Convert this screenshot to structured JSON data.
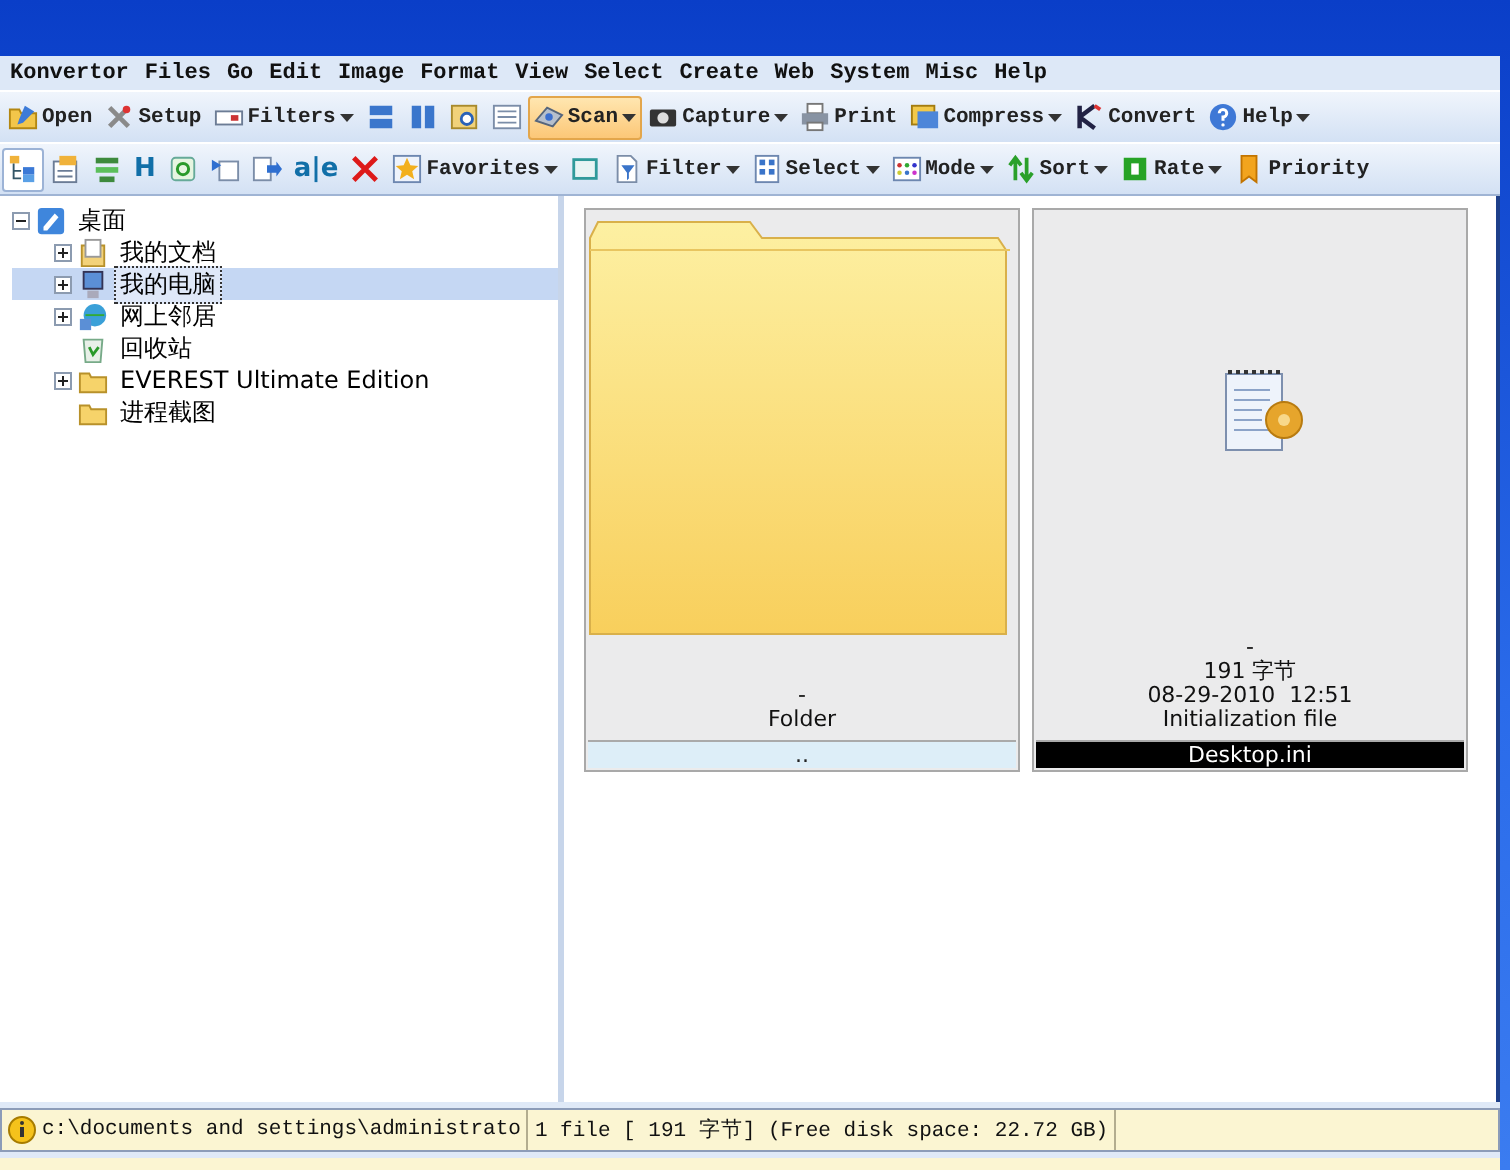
{
  "menu": [
    "Konvertor",
    "Files",
    "Go",
    "Edit",
    "Image",
    "Format",
    "View",
    "Select",
    "Create",
    "Web",
    "System",
    "Misc",
    "Help"
  ],
  "toolbar": [
    {
      "kind": "button",
      "label": "Open",
      "active": false
    },
    {
      "kind": "button",
      "label": "Setup",
      "active": false
    },
    {
      "kind": "dropdown",
      "label": "Filters",
      "active": false
    },
    {
      "kind": "icon",
      "active": false
    },
    {
      "kind": "icon",
      "active": false
    },
    {
      "kind": "icon",
      "active": false
    },
    {
      "kind": "icon",
      "active": false
    },
    {
      "kind": "dropdown",
      "label": "Scan",
      "active": true
    },
    {
      "kind": "dropdown",
      "label": "Capture",
      "active": false
    },
    {
      "kind": "button",
      "label": "Print",
      "active": false
    },
    {
      "kind": "dropdown",
      "label": "Compress",
      "active": false
    },
    {
      "kind": "button",
      "label": "Convert",
      "active": false
    },
    {
      "kind": "dropdown",
      "label": "Help",
      "active": false
    }
  ],
  "toolbar_2": [
    {
      "kind": "icon",
      "active": true
    },
    {
      "kind": "icon",
      "active": false
    },
    {
      "kind": "icon",
      "active": false
    },
    {
      "kind": "glyph",
      "label": "H",
      "active": false
    },
    {
      "kind": "icon",
      "active": false
    },
    {
      "kind": "icon",
      "active": false
    },
    {
      "kind": "icon",
      "active": false
    },
    {
      "kind": "glyph",
      "label": "a|e",
      "active": false
    },
    {
      "kind": "icon",
      "active": false
    },
    {
      "kind": "dropdown",
      "label": "Favorites",
      "active": false
    },
    {
      "kind": "icon",
      "active": false
    },
    {
      "kind": "dropdown",
      "label": "Filter",
      "active": false
    },
    {
      "kind": "dropdown",
      "label": "Select",
      "active": false
    },
    {
      "kind": "dropdown",
      "label": "Mode",
      "active": false
    },
    {
      "kind": "dropdown",
      "label": "Sort",
      "active": false
    },
    {
      "kind": "dropdown",
      "label": "Rate",
      "active": false
    },
    {
      "kind": "button",
      "label": "Priority",
      "active": false
    }
  ],
  "tree": {
    "label": "桌面",
    "kind": "expandable",
    "expanded": true,
    "selected": false,
    "children": [
      {
        "label": "我的文档",
        "kind": "expandable",
        "expanded": false,
        "selected": false
      },
      {
        "label": "我的电脑",
        "kind": "expandable",
        "expanded": false,
        "selected": true
      },
      {
        "label": "网上邻居",
        "kind": "expandable",
        "expanded": false,
        "selected": false
      },
      {
        "label": "回收站",
        "kind": "leaf",
        "selected": false
      },
      {
        "label": "EVEREST Ultimate Edition",
        "kind": "expandable",
        "expanded": false,
        "selected": false
      },
      {
        "label": "进程截图",
        "kind": "leaf",
        "selected": false
      }
    ]
  },
  "thumbnails": [
    {
      "kind": "folder",
      "lines": [
        "-",
        "Folder"
      ],
      "caption": "..",
      "selected": false
    },
    {
      "kind": "file",
      "lines": [
        "-",
        "191 字节",
        "08-29-2010  12:51",
        "Initialization file"
      ],
      "caption": "Desktop.ini",
      "selected": true
    }
  ],
  "status_bar": {
    "path": "c:\\documents and settings\\administrato",
    "info": "1 file [ 191 字节] (Free disk space: 22.72 GB)"
  }
}
